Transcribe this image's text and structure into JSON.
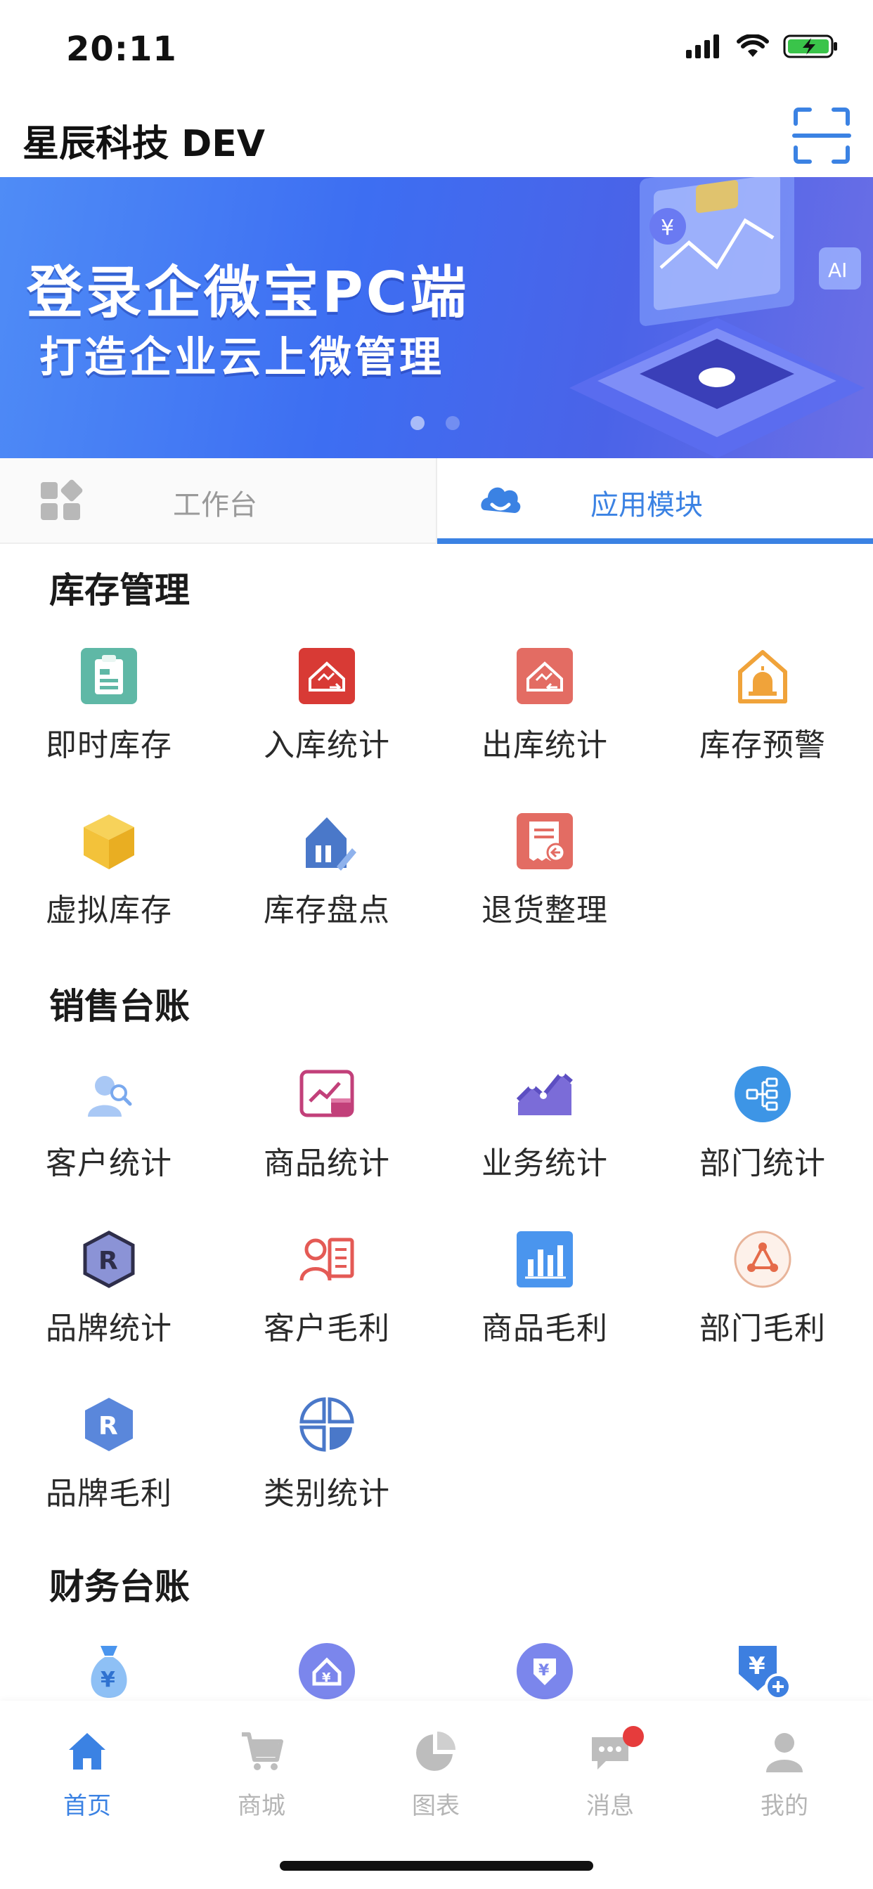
{
  "status_bar": {
    "time": "20:11"
  },
  "nav": {
    "title": "星辰科技 DEV"
  },
  "banner": {
    "line1": "登录企微宝PC端",
    "line2": "打造企业云上微管理"
  },
  "tabs": {
    "workbench": "工作台",
    "modules": "应用模块"
  },
  "sections": {
    "inventory": {
      "title": "库存管理",
      "items": [
        "即时库存",
        "入库统计",
        "出库统计",
        "库存预警",
        "虚拟库存",
        "库存盘点",
        "退货整理"
      ]
    },
    "sales": {
      "title": "销售台账",
      "items": [
        "客户统计",
        "商品统计",
        "业务统计",
        "部门统计",
        "品牌统计",
        "客户毛利",
        "商品毛利",
        "部门毛利",
        "品牌毛利",
        "类别统计"
      ]
    },
    "finance": {
      "title": "财务台账"
    }
  },
  "tabbar": {
    "home": "首页",
    "mall": "商城",
    "charts": "图表",
    "messages": "消息",
    "mine": "我的"
  },
  "colors": {
    "accent": "#3b82e3",
    "badge": "#e63c3c"
  }
}
